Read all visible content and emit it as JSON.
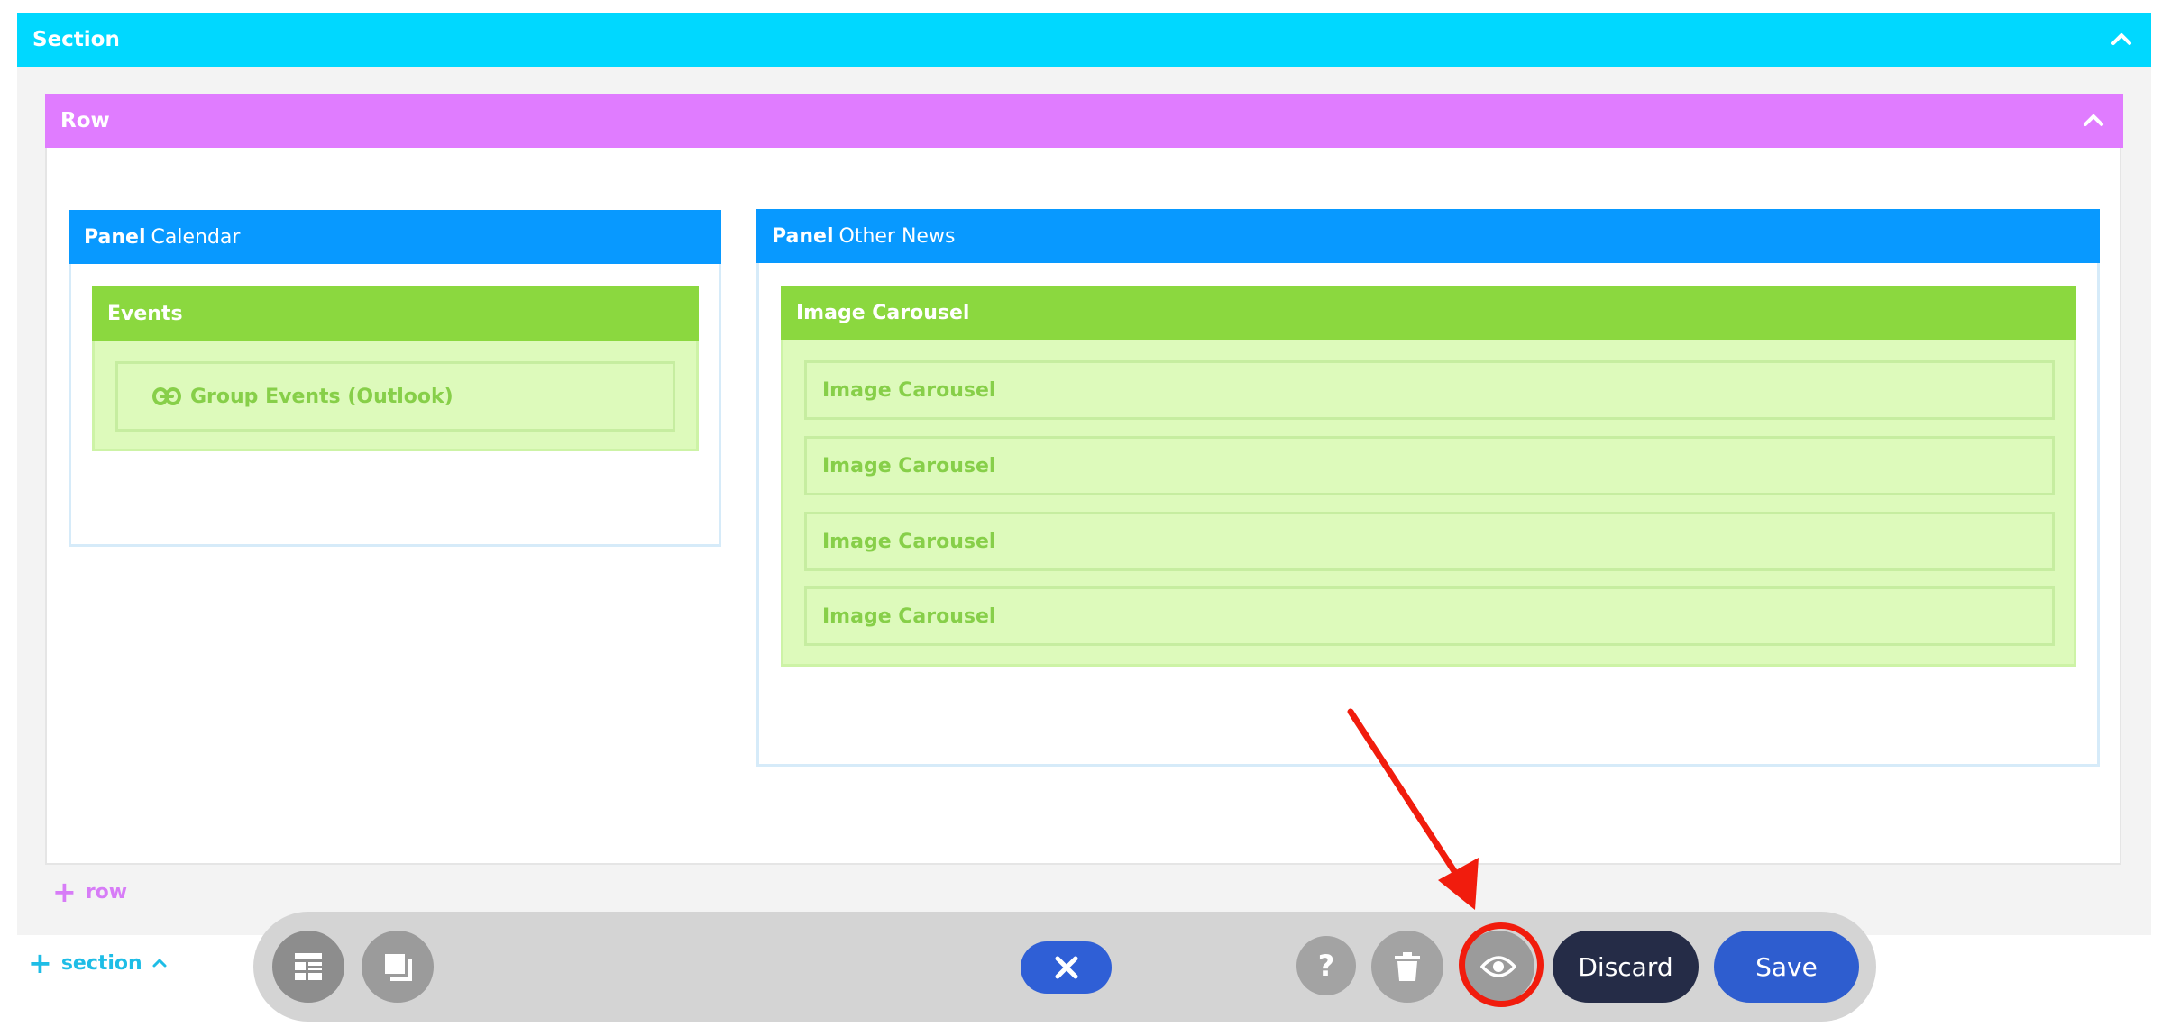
{
  "section": {
    "title": "Section"
  },
  "row": {
    "title": "Row"
  },
  "panels": [
    {
      "label": "Panel",
      "name": "Calendar"
    },
    {
      "label": "Panel",
      "name": "Other News"
    }
  ],
  "modules": {
    "events": {
      "title": "Events",
      "items": [
        "Group Events (Outlook)"
      ]
    },
    "carousel": {
      "title": "Image Carousel",
      "items": [
        "Image Carousel",
        "Image Carousel",
        "Image Carousel",
        "Image Carousel"
      ]
    }
  },
  "add": {
    "row": "row",
    "section": "section"
  },
  "toolbar": {
    "discard": "Discard",
    "save": "Save"
  },
  "colors": {
    "section": "#00d8ff",
    "row": "#e07cff",
    "panel": "#0899ff",
    "module": "#8bd83f",
    "highlight": "#f11c0d",
    "save": "#2e5dcf",
    "discard": "#252c47"
  }
}
